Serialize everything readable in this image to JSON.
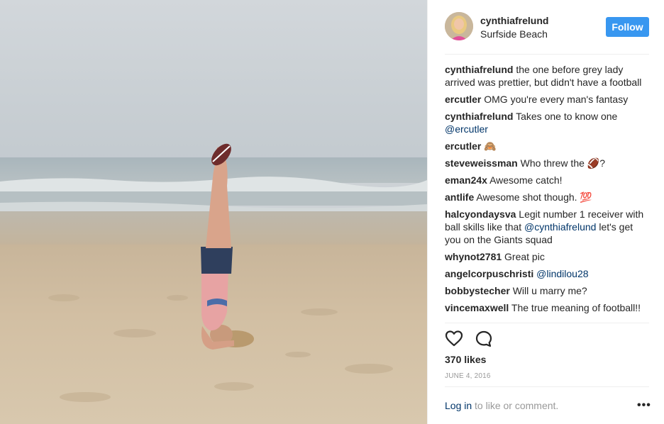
{
  "post": {
    "username": "cynthiafrelund",
    "location": "Surfside Beach",
    "follow_label": "Follow"
  },
  "comments": [
    {
      "user": "cynthiafrelund",
      "text": "the one before grey lady arrived was prettier, but didn't have a football"
    },
    {
      "user": "ercutler",
      "text": "OMG you're every man's fantasy"
    },
    {
      "user": "cynthiafrelund",
      "text": "Takes one to know one",
      "mention": "@ercutler"
    },
    {
      "user": "ercutler",
      "text": "🙈"
    },
    {
      "user": "steveweissman",
      "text": "Who threw the 🏈?"
    },
    {
      "user": "eman24x",
      "text": "Awesome catch!"
    },
    {
      "user": "antlife",
      "text": "Awesome shot though. 💯"
    },
    {
      "user": "halcyondaysva",
      "text": "Legit number 1 receiver with ball skills like that",
      "mention": "@cynthiafrelund",
      "text_after": "let's get you on the Giants squad"
    },
    {
      "user": "whynot2781",
      "text": "Great pic"
    },
    {
      "user": "angelcorpuschristi",
      "text": "",
      "mention": "@lindilou28"
    },
    {
      "user": "bobbystecher",
      "text": "Will u marry me?"
    },
    {
      "user": "vincemaxwell",
      "text": "The true meaning of football!!"
    }
  ],
  "engagement": {
    "likes": "370 likes",
    "date": "JUNE 4, 2016"
  },
  "footer": {
    "login_link": "Log in",
    "login_text": "to like or comment.",
    "more": "•••"
  },
  "icons": {
    "like": "heart-icon",
    "comment": "comment-bubble-icon",
    "more": "more-options-icon"
  },
  "colors": {
    "follow_button": "#3897f0",
    "mention": "#003569",
    "muted": "#999999"
  }
}
